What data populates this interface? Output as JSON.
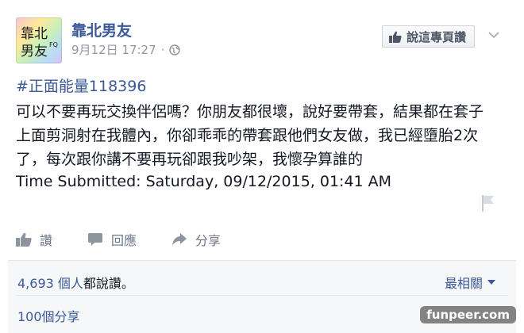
{
  "post": {
    "page_name": "靠北男友",
    "date": "9月12日 17:27",
    "separator": "·",
    "like_page_label": "說這專頁讚",
    "hashtag": "#正面能量118396",
    "body_line1": "可以不要再玩交換伴侶嗎？你朋友都很壞，說好要帶套，結果都在套子",
    "body_line2": "上面剪洞射在我體內，你卻乖乖的帶套跟他們女友做，我已經墮胎2次",
    "body_line3": "了，每次跟你講不要再玩卻跟我吵架，我懷孕算誰的",
    "submitted": "Time Submitted: Saturday, 09/12/2015, 01:41 AM"
  },
  "avatar": {
    "logo_line1": "靠北",
    "logo_line2": "男友",
    "logo_small": "FQ"
  },
  "actions": {
    "like_label": "讚",
    "comment_label": "回應",
    "share_label": "分享"
  },
  "footer": {
    "likes_count": "4,693 個人",
    "likes_suffix": "都說讚。",
    "sort_label": "最相關",
    "shares_label": "100個分享"
  },
  "watermark": "funpeer.com",
  "colors": {
    "link_blue": "#3b5998",
    "meta_gray": "#9197a3",
    "footer_bg": "#f6f7f9"
  }
}
